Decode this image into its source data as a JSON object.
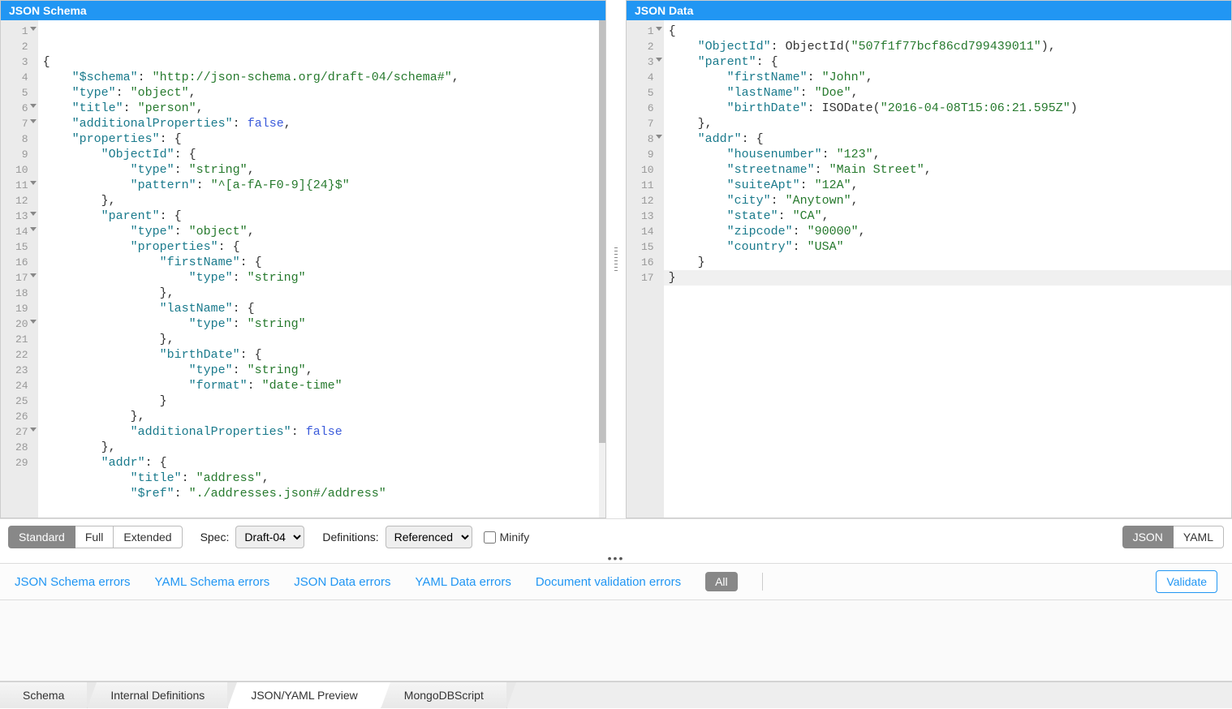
{
  "leftPanel": {
    "title": "JSON Schema",
    "lines": [
      {
        "n": 1,
        "fold": true,
        "tokens": [
          {
            "t": "{",
            "c": "punc"
          }
        ]
      },
      {
        "n": 2,
        "tokens": [
          {
            "t": "    ",
            "c": ""
          },
          {
            "t": "\"$schema\"",
            "c": "key"
          },
          {
            "t": ": ",
            "c": "punc"
          },
          {
            "t": "\"http://json-schema.org/draft-04/schema#\"",
            "c": "val"
          },
          {
            "t": ",",
            "c": "punc"
          }
        ]
      },
      {
        "n": 3,
        "tokens": [
          {
            "t": "    ",
            "c": ""
          },
          {
            "t": "\"type\"",
            "c": "key"
          },
          {
            "t": ": ",
            "c": "punc"
          },
          {
            "t": "\"object\"",
            "c": "val"
          },
          {
            "t": ",",
            "c": "punc"
          }
        ]
      },
      {
        "n": 4,
        "tokens": [
          {
            "t": "    ",
            "c": ""
          },
          {
            "t": "\"title\"",
            "c": "key"
          },
          {
            "t": ": ",
            "c": "punc"
          },
          {
            "t": "\"person\"",
            "c": "val"
          },
          {
            "t": ",",
            "c": "punc"
          }
        ]
      },
      {
        "n": 5,
        "tokens": [
          {
            "t": "    ",
            "c": ""
          },
          {
            "t": "\"additionalProperties\"",
            "c": "key"
          },
          {
            "t": ": ",
            "c": "punc"
          },
          {
            "t": "false",
            "c": "kw"
          },
          {
            "t": ",",
            "c": "punc"
          }
        ]
      },
      {
        "n": 6,
        "fold": true,
        "tokens": [
          {
            "t": "    ",
            "c": ""
          },
          {
            "t": "\"properties\"",
            "c": "key"
          },
          {
            "t": ": {",
            "c": "punc"
          }
        ]
      },
      {
        "n": 7,
        "fold": true,
        "tokens": [
          {
            "t": "        ",
            "c": ""
          },
          {
            "t": "\"ObjectId\"",
            "c": "key"
          },
          {
            "t": ": {",
            "c": "punc"
          }
        ]
      },
      {
        "n": 8,
        "tokens": [
          {
            "t": "            ",
            "c": ""
          },
          {
            "t": "\"type\"",
            "c": "key"
          },
          {
            "t": ": ",
            "c": "punc"
          },
          {
            "t": "\"string\"",
            "c": "val"
          },
          {
            "t": ",",
            "c": "punc"
          }
        ]
      },
      {
        "n": 9,
        "tokens": [
          {
            "t": "            ",
            "c": ""
          },
          {
            "t": "\"pattern\"",
            "c": "key"
          },
          {
            "t": ": ",
            "c": "punc"
          },
          {
            "t": "\"^[a-fA-F0-9]{24}$\"",
            "c": "val"
          }
        ]
      },
      {
        "n": 10,
        "tokens": [
          {
            "t": "        },",
            "c": "punc"
          }
        ]
      },
      {
        "n": 11,
        "fold": true,
        "tokens": [
          {
            "t": "        ",
            "c": ""
          },
          {
            "t": "\"parent\"",
            "c": "key"
          },
          {
            "t": ": {",
            "c": "punc"
          }
        ]
      },
      {
        "n": 12,
        "tokens": [
          {
            "t": "            ",
            "c": ""
          },
          {
            "t": "\"type\"",
            "c": "key"
          },
          {
            "t": ": ",
            "c": "punc"
          },
          {
            "t": "\"object\"",
            "c": "val"
          },
          {
            "t": ",",
            "c": "punc"
          }
        ]
      },
      {
        "n": 13,
        "fold": true,
        "tokens": [
          {
            "t": "            ",
            "c": ""
          },
          {
            "t": "\"properties\"",
            "c": "key"
          },
          {
            "t": ": {",
            "c": "punc"
          }
        ]
      },
      {
        "n": 14,
        "fold": true,
        "tokens": [
          {
            "t": "                ",
            "c": ""
          },
          {
            "t": "\"firstName\"",
            "c": "key"
          },
          {
            "t": ": {",
            "c": "punc"
          }
        ]
      },
      {
        "n": 15,
        "tokens": [
          {
            "t": "                    ",
            "c": ""
          },
          {
            "t": "\"type\"",
            "c": "key"
          },
          {
            "t": ": ",
            "c": "punc"
          },
          {
            "t": "\"string\"",
            "c": "val"
          }
        ]
      },
      {
        "n": 16,
        "tokens": [
          {
            "t": "                },",
            "c": "punc"
          }
        ]
      },
      {
        "n": 17,
        "fold": true,
        "tokens": [
          {
            "t": "                ",
            "c": ""
          },
          {
            "t": "\"lastName\"",
            "c": "key"
          },
          {
            "t": ": {",
            "c": "punc"
          }
        ]
      },
      {
        "n": 18,
        "tokens": [
          {
            "t": "                    ",
            "c": ""
          },
          {
            "t": "\"type\"",
            "c": "key"
          },
          {
            "t": ": ",
            "c": "punc"
          },
          {
            "t": "\"string\"",
            "c": "val"
          }
        ]
      },
      {
        "n": 19,
        "tokens": [
          {
            "t": "                },",
            "c": "punc"
          }
        ]
      },
      {
        "n": 20,
        "fold": true,
        "tokens": [
          {
            "t": "                ",
            "c": ""
          },
          {
            "t": "\"birthDate\"",
            "c": "key"
          },
          {
            "t": ": {",
            "c": "punc"
          }
        ]
      },
      {
        "n": 21,
        "tokens": [
          {
            "t": "                    ",
            "c": ""
          },
          {
            "t": "\"type\"",
            "c": "key"
          },
          {
            "t": ": ",
            "c": "punc"
          },
          {
            "t": "\"string\"",
            "c": "val"
          },
          {
            "t": ",",
            "c": "punc"
          }
        ]
      },
      {
        "n": 22,
        "tokens": [
          {
            "t": "                    ",
            "c": ""
          },
          {
            "t": "\"format\"",
            "c": "key"
          },
          {
            "t": ": ",
            "c": "punc"
          },
          {
            "t": "\"date-time\"",
            "c": "val"
          }
        ]
      },
      {
        "n": 23,
        "tokens": [
          {
            "t": "                }",
            "c": "punc"
          }
        ]
      },
      {
        "n": 24,
        "tokens": [
          {
            "t": "            },",
            "c": "punc"
          }
        ]
      },
      {
        "n": 25,
        "tokens": [
          {
            "t": "            ",
            "c": ""
          },
          {
            "t": "\"additionalProperties\"",
            "c": "key"
          },
          {
            "t": ": ",
            "c": "punc"
          },
          {
            "t": "false",
            "c": "kw"
          }
        ]
      },
      {
        "n": 26,
        "tokens": [
          {
            "t": "        },",
            "c": "punc"
          }
        ]
      },
      {
        "n": 27,
        "fold": true,
        "tokens": [
          {
            "t": "        ",
            "c": ""
          },
          {
            "t": "\"addr\"",
            "c": "key"
          },
          {
            "t": ": {",
            "c": "punc"
          }
        ]
      },
      {
        "n": 28,
        "tokens": [
          {
            "t": "            ",
            "c": ""
          },
          {
            "t": "\"title\"",
            "c": "key"
          },
          {
            "t": ": ",
            "c": "punc"
          },
          {
            "t": "\"address\"",
            "c": "val"
          },
          {
            "t": ",",
            "c": "punc"
          }
        ]
      },
      {
        "n": 29,
        "tokens": [
          {
            "t": "            ",
            "c": ""
          },
          {
            "t": "\"$ref\"",
            "c": "key"
          },
          {
            "t": ": ",
            "c": "punc"
          },
          {
            "t": "\"./addresses.json#/address\"",
            "c": "val"
          }
        ]
      }
    ]
  },
  "rightPanel": {
    "title": "JSON Data",
    "lines": [
      {
        "n": 1,
        "fold": true,
        "tokens": [
          {
            "t": "{",
            "c": "punc"
          }
        ]
      },
      {
        "n": 2,
        "tokens": [
          {
            "t": "    ",
            "c": ""
          },
          {
            "t": "\"ObjectId\"",
            "c": "key"
          },
          {
            "t": ": ",
            "c": "punc"
          },
          {
            "t": "ObjectId(",
            "c": "ident"
          },
          {
            "t": "\"507f1f77bcf86cd799439011\"",
            "c": "val"
          },
          {
            "t": "),",
            "c": "ident"
          }
        ]
      },
      {
        "n": 3,
        "fold": true,
        "tokens": [
          {
            "t": "    ",
            "c": ""
          },
          {
            "t": "\"parent\"",
            "c": "key"
          },
          {
            "t": ": {",
            "c": "punc"
          }
        ]
      },
      {
        "n": 4,
        "tokens": [
          {
            "t": "        ",
            "c": ""
          },
          {
            "t": "\"firstName\"",
            "c": "key"
          },
          {
            "t": ": ",
            "c": "punc"
          },
          {
            "t": "\"John\"",
            "c": "val"
          },
          {
            "t": ",",
            "c": "punc"
          }
        ]
      },
      {
        "n": 5,
        "tokens": [
          {
            "t": "        ",
            "c": ""
          },
          {
            "t": "\"lastName\"",
            "c": "key"
          },
          {
            "t": ": ",
            "c": "punc"
          },
          {
            "t": "\"Doe\"",
            "c": "val"
          },
          {
            "t": ",",
            "c": "punc"
          }
        ]
      },
      {
        "n": 6,
        "tokens": [
          {
            "t": "        ",
            "c": ""
          },
          {
            "t": "\"birthDate\"",
            "c": "key"
          },
          {
            "t": ": ",
            "c": "punc"
          },
          {
            "t": "ISODate(",
            "c": "ident"
          },
          {
            "t": "\"2016-04-08T15:06:21.595Z\"",
            "c": "val"
          },
          {
            "t": ")",
            "c": "ident"
          }
        ]
      },
      {
        "n": 7,
        "tokens": [
          {
            "t": "    },",
            "c": "punc"
          }
        ]
      },
      {
        "n": 8,
        "fold": true,
        "tokens": [
          {
            "t": "    ",
            "c": ""
          },
          {
            "t": "\"addr\"",
            "c": "key"
          },
          {
            "t": ": {",
            "c": "punc"
          }
        ]
      },
      {
        "n": 9,
        "tokens": [
          {
            "t": "        ",
            "c": ""
          },
          {
            "t": "\"housenumber\"",
            "c": "key"
          },
          {
            "t": ": ",
            "c": "punc"
          },
          {
            "t": "\"123\"",
            "c": "val"
          },
          {
            "t": ",",
            "c": "punc"
          }
        ]
      },
      {
        "n": 10,
        "tokens": [
          {
            "t": "        ",
            "c": ""
          },
          {
            "t": "\"streetname\"",
            "c": "key"
          },
          {
            "t": ": ",
            "c": "punc"
          },
          {
            "t": "\"Main Street\"",
            "c": "val"
          },
          {
            "t": ",",
            "c": "punc"
          }
        ]
      },
      {
        "n": 11,
        "tokens": [
          {
            "t": "        ",
            "c": ""
          },
          {
            "t": "\"suiteApt\"",
            "c": "key"
          },
          {
            "t": ": ",
            "c": "punc"
          },
          {
            "t": "\"12A\"",
            "c": "val"
          },
          {
            "t": ",",
            "c": "punc"
          }
        ]
      },
      {
        "n": 12,
        "tokens": [
          {
            "t": "        ",
            "c": ""
          },
          {
            "t": "\"city\"",
            "c": "key"
          },
          {
            "t": ": ",
            "c": "punc"
          },
          {
            "t": "\"Anytown\"",
            "c": "val"
          },
          {
            "t": ",",
            "c": "punc"
          }
        ]
      },
      {
        "n": 13,
        "tokens": [
          {
            "t": "        ",
            "c": ""
          },
          {
            "t": "\"state\"",
            "c": "key"
          },
          {
            "t": ": ",
            "c": "punc"
          },
          {
            "t": "\"CA\"",
            "c": "val"
          },
          {
            "t": ",",
            "c": "punc"
          }
        ]
      },
      {
        "n": 14,
        "tokens": [
          {
            "t": "        ",
            "c": ""
          },
          {
            "t": "\"zipcode\"",
            "c": "key"
          },
          {
            "t": ": ",
            "c": "punc"
          },
          {
            "t": "\"90000\"",
            "c": "val"
          },
          {
            "t": ",",
            "c": "punc"
          }
        ]
      },
      {
        "n": 15,
        "tokens": [
          {
            "t": "        ",
            "c": ""
          },
          {
            "t": "\"country\"",
            "c": "key"
          },
          {
            "t": ": ",
            "c": "punc"
          },
          {
            "t": "\"USA\"",
            "c": "val"
          }
        ]
      },
      {
        "n": 16,
        "tokens": [
          {
            "t": "    }",
            "c": "punc"
          }
        ]
      },
      {
        "n": 17,
        "hl": true,
        "tokens": [
          {
            "t": "}",
            "c": "punc"
          }
        ]
      }
    ]
  },
  "toolbar": {
    "modes": [
      "Standard",
      "Full",
      "Extended"
    ],
    "mode_active": 0,
    "spec_label": "Spec:",
    "spec_options": [
      "Draft-04"
    ],
    "definitions_label": "Definitions:",
    "definitions_options": [
      "Referenced"
    ],
    "minify_label": "Minify",
    "format_buttons": [
      "JSON",
      "YAML"
    ],
    "format_active": 0
  },
  "errorsBar": {
    "links": [
      "JSON Schema errors",
      "YAML Schema errors",
      "JSON Data errors",
      "YAML Data errors",
      "Document validation errors"
    ],
    "all_label": "All",
    "validate_label": "Validate"
  },
  "bottomTabs": {
    "tabs": [
      "Schema",
      "Internal Definitions",
      "JSON/YAML Preview",
      "MongoDBScript"
    ],
    "active": 2
  }
}
